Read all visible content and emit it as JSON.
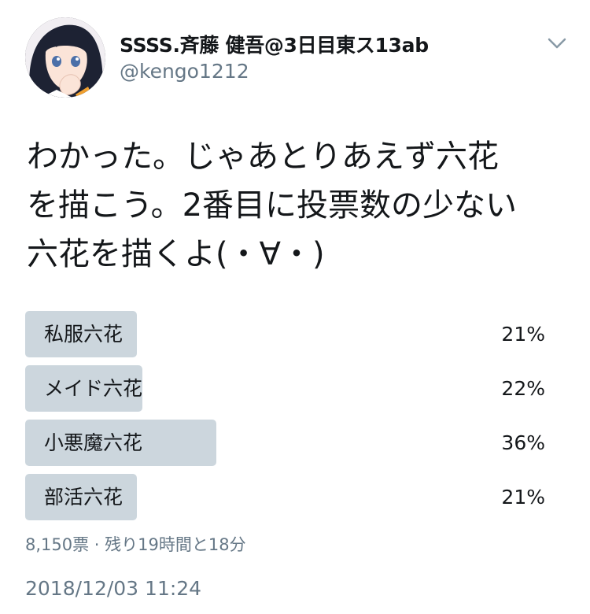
{
  "author": {
    "display_name": "SSSS.斉藤 健吾@3日目東ス13ab",
    "handle": "@kengo1212"
  },
  "tweet": {
    "lines": [
      "わかった。じゃあとりあえず六花",
      "を描こう。2番目に投票数の少ない",
      "六花を描くよ(・∀・)"
    ]
  },
  "poll": {
    "options": [
      {
        "label": "私服六花",
        "percent_text": "21%",
        "percent": 21
      },
      {
        "label": "メイド六花",
        "percent_text": "22%",
        "percent": 22
      },
      {
        "label": "小悪魔六花",
        "percent_text": "36%",
        "percent": 36
      },
      {
        "label": "部活六花",
        "percent_text": "21%",
        "percent": 21
      }
    ],
    "meta": "8,150票 · 残り19時間と18分"
  },
  "timestamp": "2018/12/03 11:24",
  "colors": {
    "bar_fill": "#ccd6dd",
    "secondary_text": "#657786",
    "primary_text": "#14171a"
  },
  "icons": {
    "menu": "chevron-down-icon"
  }
}
